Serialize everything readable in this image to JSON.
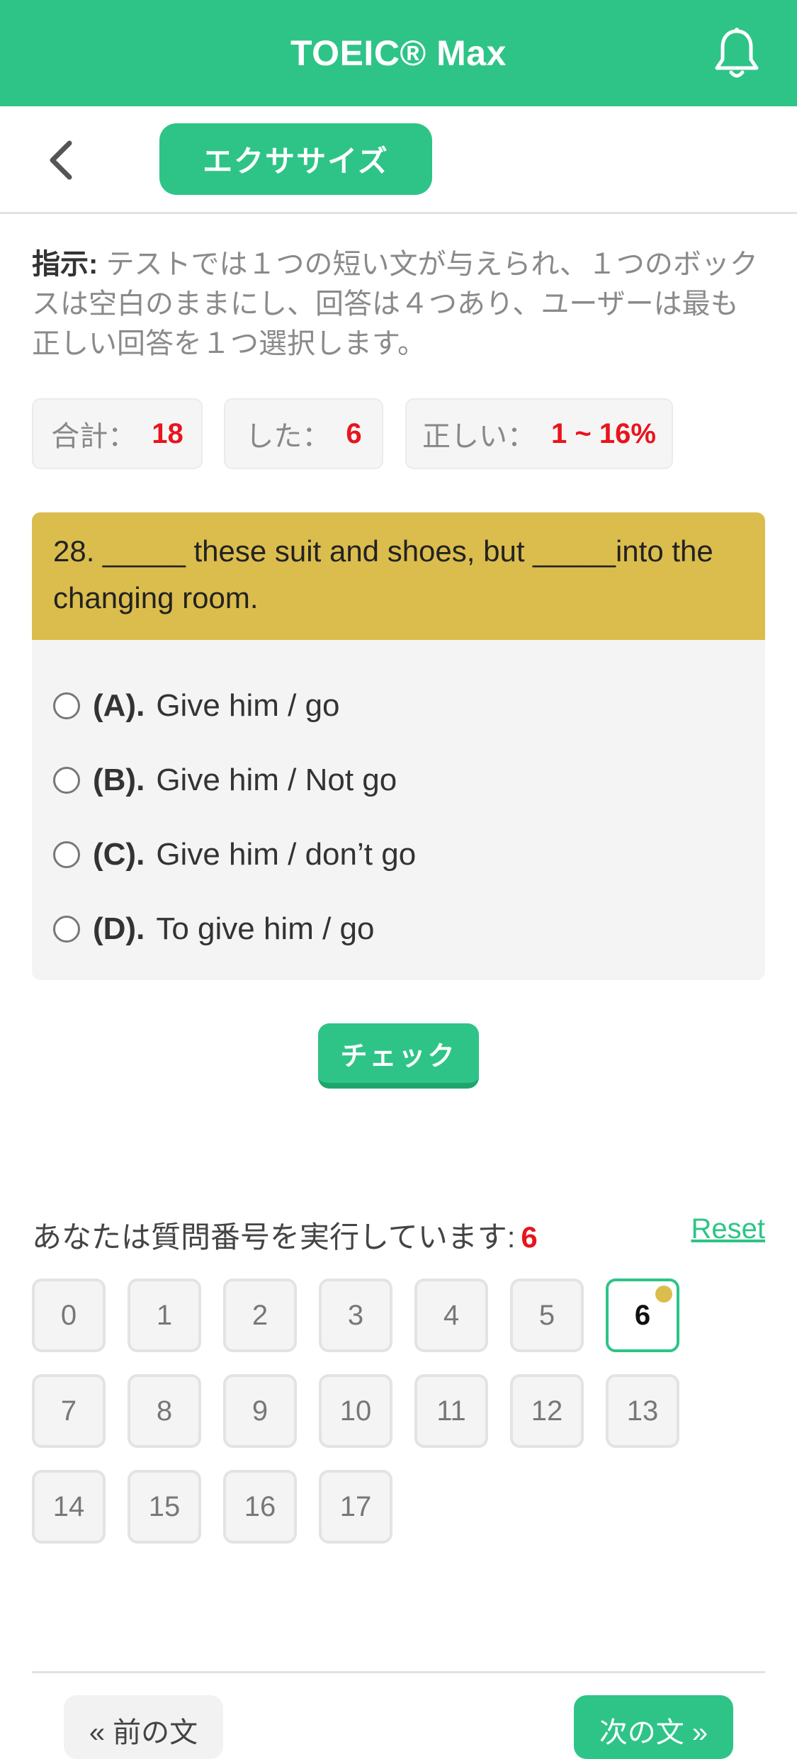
{
  "header": {
    "title": "TOEIC® Max",
    "bell_icon": "bell-icon"
  },
  "toolbar": {
    "back_icon": "chevron-left-icon",
    "exercise_label": "エクササイズ"
  },
  "instruction": {
    "label": "指示:",
    "text": " テストでは１つの短い文が与えられ、１つのボックスは空白のままにし、回答は４つあり、ユーザーは最も正しい回答を１つ選択します。"
  },
  "stats": {
    "total_label": "合計：",
    "total_value": "18",
    "done_label": "した：",
    "done_value": "6",
    "correct_label": "正しい：",
    "correct_value": "1 ~ 16%"
  },
  "question": {
    "text": "28. _____ these suit and shoes, but _____into the changing room.",
    "options": [
      {
        "letter": "(A).",
        "text": "Give him / go"
      },
      {
        "letter": "(B).",
        "text": "Give him / Not go"
      },
      {
        "letter": "(C).",
        "text": "Give him / don’t go"
      },
      {
        "letter": "(D).",
        "text": "To give him / go"
      }
    ]
  },
  "check_label": "チェック",
  "progress": {
    "label": "あなたは質問番号を実行しています:",
    "current": "6",
    "reset_label": "Reset",
    "numbers": [
      "0",
      "1",
      "2",
      "3",
      "4",
      "5",
      "6",
      "7",
      "8",
      "9",
      "10",
      "11",
      "12",
      "13",
      "14",
      "15",
      "16",
      "17"
    ]
  },
  "nav": {
    "prev_label": "« 前の文",
    "next_label": "次の文 »"
  },
  "colors": {
    "accent": "#2ec487",
    "question_header": "#dbbd4d",
    "highlight_red": "#e8141e"
  }
}
